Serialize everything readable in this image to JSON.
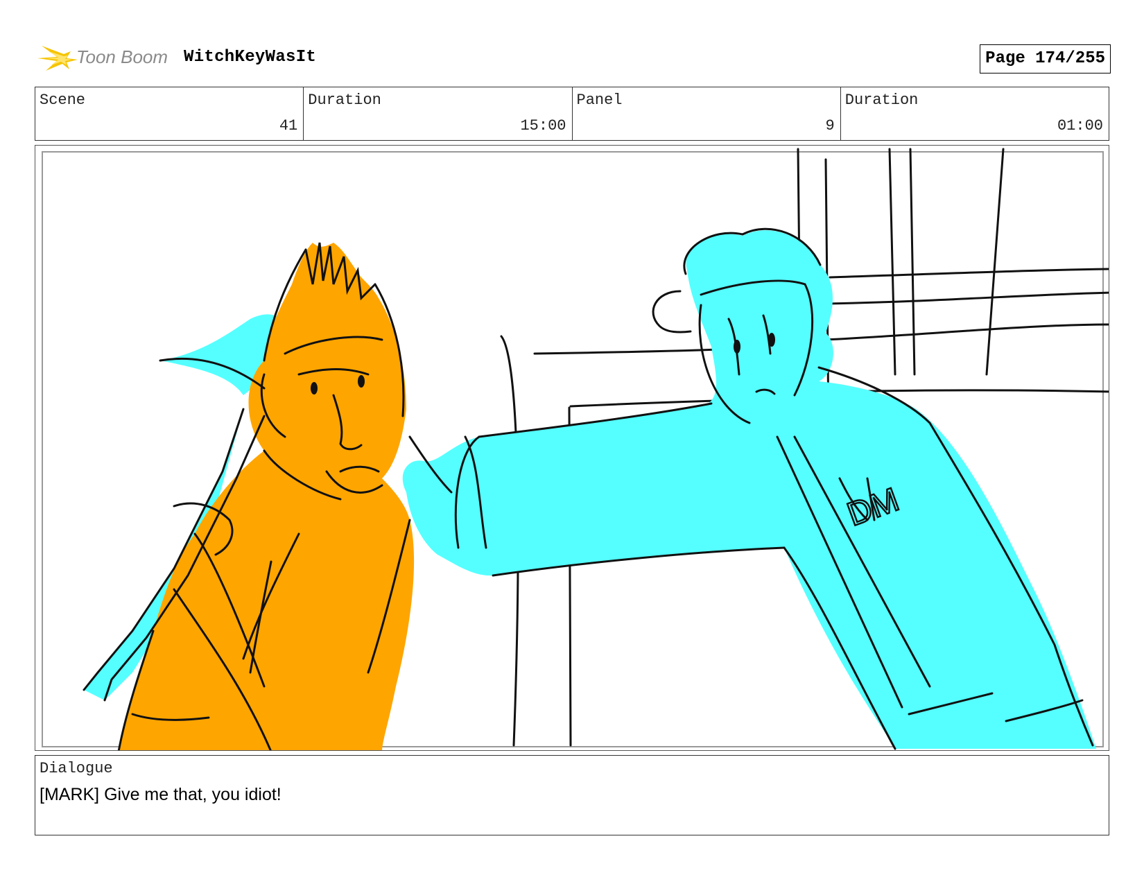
{
  "header": {
    "logo_text": "Toon Boom",
    "project_title": "WitchKeyWasIt",
    "page_label": "Page 174/255"
  },
  "info": {
    "scene_label": "Scene",
    "scene_value": "41",
    "scene_duration_label": "Duration",
    "scene_duration_value": "15:00",
    "panel_label": "Panel",
    "panel_value": "9",
    "panel_duration_label": "Duration",
    "panel_duration_value": "01:00"
  },
  "dialogue": {
    "label": "Dialogue",
    "text": "[MARK] Give me that, you idiot!"
  },
  "colors": {
    "orange_character": "#FFA500",
    "cyan_character": "#55FFFF",
    "logo_yellow": "#F5C400",
    "ink": "#111111"
  }
}
